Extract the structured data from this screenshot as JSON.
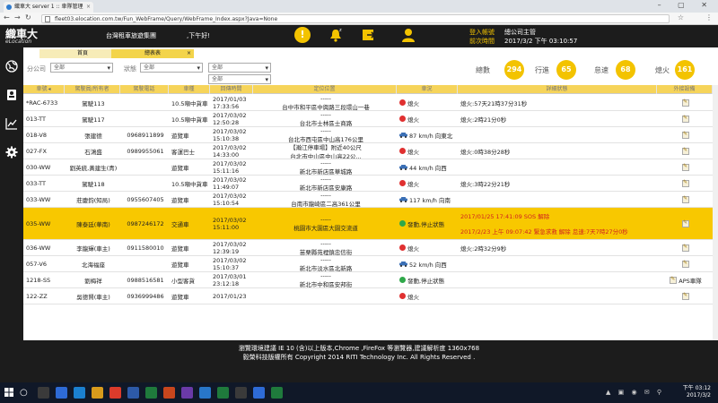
{
  "browser": {
    "tab_title": "織車大 server 1 :: 車隊管理",
    "url": "fleet03.elocation.com.tw/Fun_WebFrame/Query/WebFrame_Index.aspx?Java=None"
  },
  "header": {
    "logo": "織車大",
    "logo_sub": "eLocation",
    "company": "台灣租車旅遊集團",
    "greeting": ",下午好!",
    "login_label": "登入帳號",
    "login_value": "總公司主管",
    "time_label": "前次時間",
    "time_value": "2017/3/2 下午 03:10:57",
    "icons": [
      "alert-icon",
      "bell-icon",
      "exit-icon",
      "user-icon"
    ]
  },
  "rail": {
    "icons": [
      "globe-icon",
      "contacts-icon",
      "chart-icon",
      "gear-icon"
    ]
  },
  "tabs": [
    {
      "label": "首頁"
    },
    {
      "label": "總表表"
    }
  ],
  "filters": {
    "company_label": "分公司",
    "company_value": "全部",
    "status_label": "狀態",
    "status_value": "全部",
    "vehicle_value": "全部",
    "fourth_value": "全部"
  },
  "stats": [
    {
      "label": "總數",
      "value": "294"
    },
    {
      "label": "行進",
      "value": "65"
    },
    {
      "label": "怠速",
      "value": "68"
    },
    {
      "label": "熄火",
      "value": "161"
    }
  ],
  "table": {
    "headers": [
      "車號",
      "駕駛員/所有者",
      "駕駛電話",
      "車種",
      "回傳時間",
      "定位位置",
      "車況",
      "詳細狀態",
      "外接設備"
    ],
    "rows": [
      {
        "plate": "*RAC-6733",
        "driver": "駕駛113",
        "phone": "",
        "type": "10.5噸中貨車",
        "date": "2017/01/03",
        "time": "17:33:56",
        "loc1": "-----",
        "loc2": "台中市和平區中興路三段環山一巷",
        "status": "熄火",
        "status_kind": "off",
        "detail": "熄火:57天21時37分31秒",
        "alarm": ""
      },
      {
        "plate": "013-TT",
        "driver": "駕駛117",
        "phone": "",
        "type": "10.5噸中貨車",
        "date": "2017/03/02",
        "time": "12:50:28",
        "loc1": "-----",
        "loc2": "台北市士林區士商路",
        "status": "熄火",
        "status_kind": "off",
        "detail": "熄火:2時21分0秒",
        "alarm": ""
      },
      {
        "plate": "018-V8",
        "driver": "張建德",
        "phone": "0968911899",
        "type": "遊覽車",
        "date": "2017/03/02",
        "time": "15:10:38",
        "loc1": "-----",
        "loc2": "台北市西屯區中山高176公里",
        "status": "87 km/h 向東北",
        "status_kind": "car",
        "detail": "",
        "alarm": ""
      },
      {
        "plate": "027-FX",
        "driver": "石鴻盛",
        "phone": "0989955061",
        "type": "客運巴士",
        "date": "2017/03/02",
        "time": "14:33:00",
        "loc1": "【瀚江停車場】附近40公尺",
        "loc2": "台北市中山區中山高22公...",
        "status": "熄火",
        "status_kind": "off",
        "detail": "熄火:0時38分28秒",
        "alarm": ""
      },
      {
        "plate": "030-WW",
        "driver": "劉英統,黃建生(青)",
        "phone": "",
        "type": "遊覽車",
        "date": "2017/03/02",
        "time": "15:11:16",
        "loc1": "-----",
        "loc2": "新北市新店區華城路",
        "status": "44 km/h 向西",
        "status_kind": "car",
        "detail": "",
        "alarm": ""
      },
      {
        "plate": "033-TT",
        "driver": "駕駛118",
        "phone": "",
        "type": "10.5噸中貨車",
        "date": "2017/03/02",
        "time": "11:49:07",
        "loc1": "-----",
        "loc2": "新北市新店區安康路",
        "status": "熄火",
        "status_kind": "off",
        "detail": "熄火:3時22分21秒",
        "alarm": ""
      },
      {
        "plate": "033-WW",
        "driver": "莊慶鈞(知局)",
        "phone": "0955607405",
        "type": "遊覽車",
        "date": "2017/03/02",
        "time": "15:10:54",
        "loc1": "-----",
        "loc2": "台南市龍崎區二高361公里",
        "status": "117 km/h 向南",
        "status_kind": "car",
        "detail": "",
        "alarm": ""
      },
      {
        "plate": "035-WW",
        "driver": "陳泰廷(華南)",
        "phone": "0987246172",
        "type": "交通車",
        "date": "2017/03/02",
        "time": "15:11:00",
        "loc1": "-----",
        "loc2": "桃園市大園區大園交流道",
        "status": "發動,停止狀態",
        "status_kind": "on",
        "detail": "",
        "alarm": "2017/01/25 17:41:09 SOS 解除",
        "alarm2": "2017/2/23 上午 09:07:42 緊急求救 解除 怠速:7天7時27分0秒",
        "highlight": true
      },
      {
        "plate": "036-WW",
        "driver": "李龍輝(車主)",
        "phone": "0911580010",
        "type": "遊覽車",
        "date": "2017/03/02",
        "time": "12:39:19",
        "loc1": "-----",
        "loc2": "苗栗縣苑裡鎮忠信街",
        "status": "熄火",
        "status_kind": "off",
        "detail": "熄火:2時32分9秒",
        "alarm": ""
      },
      {
        "plate": "057-V6",
        "driver": "北海福座",
        "phone": "",
        "type": "遊覽車",
        "date": "2017/03/02",
        "time": "15:10:37",
        "loc1": "-----",
        "loc2": "新北市淡水區北新路",
        "status": "52 km/h 向西",
        "status_kind": "car",
        "detail": "",
        "alarm": ""
      },
      {
        "plate": "1218-SS",
        "driver": "劉梅祥",
        "phone": "0988516581",
        "type": "小型客貨",
        "date": "2017/03/01",
        "time": "23:12:18",
        "loc1": "-----",
        "loc2": "新北市中和區安邦街",
        "status": "發動,停止狀態",
        "status_kind": "on",
        "detail": "",
        "alarm": "",
        "extra": "APS車隊"
      },
      {
        "plate": "122-ZZ",
        "driver": "吳德賢(車主)",
        "phone": "0936999486",
        "type": "遊覽車",
        "date": "2017/01/23",
        "time": "",
        "loc1": "",
        "loc2": "",
        "status": "熄火",
        "status_kind": "off",
        "detail": "",
        "alarm": ""
      }
    ]
  },
  "footer": {
    "line1": "瀏覽環境建議 IE 10 (含)以上版本,Chrome ,FireFox 等瀏覽器,建議解析度 1360x768",
    "line2": "毅榮科技版權所有 Copyright 2014 RITI Technology Inc. All Rights Reserved ."
  },
  "taskbar": {
    "clock_time": "下午 03:12",
    "clock_date": "2017/3/2"
  }
}
